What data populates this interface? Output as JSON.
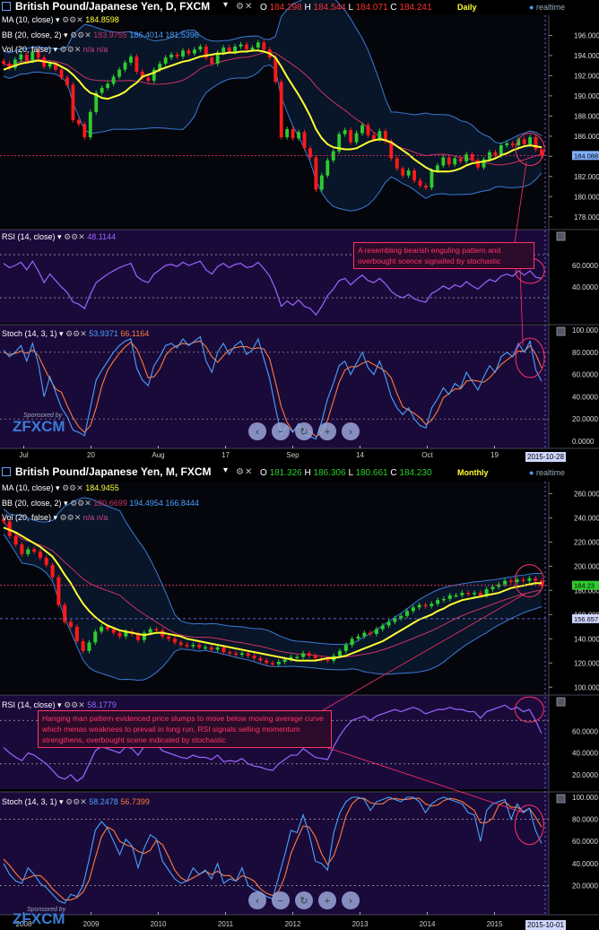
{
  "colors": {
    "bg": "#000000",
    "panel_price": "#04060c",
    "panel_ind": "#1a0a3a",
    "bull": "#2ecc2e",
    "bear": "#ff1a1a",
    "ma": "#ffff33",
    "bb": "#3a7bd5",
    "bb_mid": "#cc3366",
    "rsi": "#9966ff",
    "stoch_k": "#4aa3ff",
    "stoch_d": "#ff7a3a",
    "annotation": "#ff3366",
    "axis_text": "#ffffff"
  },
  "daily": {
    "title": "British Pound/Japanese Yen, D, FXCM",
    "ohlc": {
      "o_label": "O",
      "o": "184.298",
      "h_label": "H",
      "h": "184.544",
      "l_label": "L",
      "l": "184.071",
      "c_label": "C",
      "c": "184.241"
    },
    "period_label": "Daily",
    "realtime": "realtime",
    "ma": {
      "label": "MA (10, close)",
      "value": "184.8598"
    },
    "bb": {
      "label": "BB (20, close, 2)",
      "mid": "183.9755",
      "upper": "186.4014",
      "lower": "181.5396"
    },
    "vol": {
      "label": "Vol (20, false)",
      "value": "n/a n/a"
    },
    "price_ticks": [
      "196.000",
      "194.000",
      "192.000",
      "190.000",
      "188.000",
      "186.000",
      "184.000",
      "182.000",
      "180.000",
      "178.000"
    ],
    "last_price": "184.088",
    "rsi": {
      "label": "RSI (14, close)",
      "value": "48.1144",
      "ticks": [
        "60.0000",
        "40.0000"
      ]
    },
    "stoch": {
      "label": "Stoch (14, 3, 1)",
      "k": "53.9371",
      "d": "66.1164",
      "ticks": [
        "100.000",
        "80.0000",
        "60.0000",
        "40.0000",
        "20.0000",
        "0.0000"
      ]
    },
    "x_labels": [
      "Jul",
      "20",
      "Aug",
      "17",
      "Sep",
      "14",
      "Oct",
      "19"
    ],
    "date_badge": "2015-10-28",
    "annotation": "A resembling bearish enguling pattern and overbought scence signalled by stochastic",
    "sponsored": "Sponsored by",
    "brand": "FXCM"
  },
  "monthly": {
    "title": "British Pound/Japanese Yen, M, FXCM",
    "ohlc": {
      "o_label": "O",
      "o": "181.326",
      "h_label": "H",
      "h": "186.306",
      "l_label": "L",
      "l": "180.661",
      "c_label": "C",
      "c": "184.230"
    },
    "period_label": "Monthly",
    "realtime": "realtime",
    "ma": {
      "label": "MA (10, close)",
      "value": "184.9455"
    },
    "bb": {
      "label": "BB (20, close, 2)",
      "mid": "180.6699",
      "upper": "194.4954",
      "lower": "166.8444"
    },
    "vol": {
      "label": "Vol (20, false)",
      "value": "n/a n/a"
    },
    "price_ticks": [
      "260.000",
      "240.000",
      "220.000",
      "200.000",
      "180.000",
      "160.000",
      "140.000",
      "120.000",
      "100.000"
    ],
    "last_price": "184.23",
    "level_price": "156.657",
    "rsi": {
      "label": "RSI (14, close)",
      "value": "58.1779",
      "ticks": [
        "60.0000",
        "40.0000",
        "20.0000"
      ]
    },
    "stoch": {
      "label": "Stoch (14, 3, 1)",
      "k": "58.2478",
      "d": "56.7399",
      "ticks": [
        "100.000",
        "80.0000",
        "60.0000",
        "40.0000",
        "20.0000"
      ]
    },
    "x_labels": [
      "2008",
      "2009",
      "2010",
      "2011",
      "2012",
      "2013",
      "2014",
      "2015"
    ],
    "date_badge": "2015-10-01",
    "annotation": "Hanging man pattern evidenced price slumps to  move below moving average curve which menas weakness to prevail in long run, RSI signals selling momentum strengthens, overbought scene indicated by stochastic",
    "sponsored": "Sponsored by",
    "brand": "FXCM"
  },
  "chart_data": [
    {
      "type": "candlestick",
      "title": "British Pound/Japanese Yen, D, FXCM",
      "x_ticks": [
        "Jul",
        "20",
        "Aug",
        "17",
        "Sep",
        "14",
        "Oct",
        "19"
      ],
      "ylim": [
        177,
        198
      ],
      "close": [
        193.2,
        192.8,
        193.6,
        194.1,
        193.5,
        194.4,
        193.8,
        192.9,
        193.2,
        192.6,
        191.8,
        191.1,
        187.6,
        187.2,
        185.9,
        188.4,
        190.3,
        190.8,
        191.2,
        191.9,
        192.6,
        193.3,
        193.9,
        192.4,
        191.8,
        191.5,
        192.6,
        193.2,
        193.8,
        194.1,
        193.9,
        194.5,
        194.2,
        194.6,
        194.9,
        193.8,
        193.2,
        194.3,
        194.8,
        194.4,
        194.9,
        195.1,
        194.6,
        194.8,
        195.3,
        194.6,
        193.8,
        191.4,
        185.9,
        186.7,
        185.8,
        186.4,
        184.8,
        183.9,
        180.7,
        182.1,
        183.6,
        184.5,
        186.2,
        186.6,
        185.4,
        186.3,
        187.1,
        186.1,
        185.7,
        186.5,
        185.5,
        183.8,
        182.8,
        182.1,
        182.6,
        181.6,
        181.1,
        180.9,
        182.6,
        183.1,
        183.9,
        183.2,
        183.8,
        183.5,
        184.2,
        183.6,
        182.9,
        183.7,
        184.4,
        184.1,
        185.1,
        185.3,
        185.1,
        185.7,
        185.2,
        185.9,
        184.7,
        184.1
      ],
      "ma10": [
        192.6,
        192.8,
        193.0,
        193.2,
        193.3,
        193.4,
        193.5,
        193.4,
        193.3,
        193.2,
        192.9,
        192.6,
        192.1,
        191.5,
        190.8,
        190.3,
        190.1,
        189.8,
        189.7,
        189.9,
        190.1,
        190.4,
        190.9,
        191.3,
        191.9,
        192.1,
        192.3,
        192.6,
        192.8,
        193.0,
        193.2,
        193.4,
        193.5,
        193.7,
        193.9,
        194.0,
        194.1,
        194.2,
        194.2,
        194.3,
        194.3,
        194.4,
        194.4,
        194.5,
        194.5,
        194.4,
        194.2,
        193.8,
        192.9,
        191.9,
        191.0,
        190.1,
        189.1,
        188.0,
        186.7,
        185.8,
        185.2,
        184.9,
        184.8,
        184.7,
        184.7,
        184.8,
        185.1,
        185.4,
        185.6,
        185.7,
        185.6,
        185.4,
        185.0,
        184.6,
        184.2,
        183.7,
        183.3,
        182.9,
        182.6,
        182.5,
        182.5,
        182.5,
        182.6,
        182.8,
        183.1,
        183.3,
        183.4,
        183.5,
        183.6,
        183.8,
        184.1,
        184.3,
        184.6,
        184.8,
        185.0,
        185.1,
        185.0,
        184.9
      ],
      "rsi": [
        62,
        58,
        60,
        63,
        56,
        64,
        55,
        44,
        52,
        46,
        40,
        35,
        26,
        24,
        20,
        33,
        44,
        48,
        52,
        55,
        58,
        60,
        62,
        50,
        46,
        44,
        52,
        56,
        60,
        61,
        59,
        63,
        60,
        62,
        64,
        56,
        52,
        59,
        62,
        58,
        61,
        62,
        58,
        59,
        63,
        57,
        50,
        38,
        22,
        27,
        23,
        28,
        22,
        20,
        14,
        22,
        32,
        38,
        46,
        48,
        42,
        47,
        51,
        46,
        44,
        48,
        43,
        36,
        32,
        30,
        33,
        29,
        27,
        26,
        34,
        37,
        41,
        38,
        42,
        40,
        45,
        41,
        38,
        43,
        47,
        45,
        50,
        52,
        50,
        55,
        51,
        55,
        49,
        48
      ],
      "stoch_k": [
        82,
        76,
        80,
        86,
        72,
        88,
        70,
        40,
        58,
        44,
        30,
        22,
        10,
        8,
        5,
        30,
        55,
        64,
        72,
        80,
        86,
        90,
        92,
        66,
        55,
        50,
        68,
        76,
        86,
        88,
        84,
        92,
        86,
        90,
        94,
        72,
        62,
        80,
        88,
        78,
        86,
        90,
        78,
        82,
        92,
        74,
        56,
        30,
        6,
        14,
        8,
        16,
        6,
        4,
        2,
        18,
        38,
        52,
        68,
        72,
        60,
        70,
        80,
        66,
        60,
        72,
        58,
        40,
        30,
        24,
        30,
        20,
        14,
        12,
        30,
        38,
        48,
        42,
        52,
        48,
        62,
        54,
        46,
        58,
        68,
        62,
        76,
        80,
        76,
        88,
        80,
        90,
        64,
        54
      ],
      "stoch_d": [
        80,
        78,
        79,
        81,
        79,
        82,
        77,
        66,
        56,
        47,
        44,
        32,
        21,
        13,
        8,
        14,
        30,
        50,
        64,
        72,
        79,
        85,
        89,
        83,
        71,
        57,
        58,
        65,
        77,
        83,
        86,
        88,
        87,
        89,
        90,
        85,
        76,
        71,
        77,
        82,
        84,
        85,
        85,
        83,
        84,
        83,
        74,
        53,
        31,
        17,
        9,
        13,
        10,
        9,
        4,
        8,
        19,
        36,
        53,
        64,
        67,
        67,
        70,
        72,
        69,
        66,
        63,
        57,
        43,
        31,
        28,
        25,
        21,
        15,
        19,
        27,
        39,
        43,
        47,
        47,
        54,
        55,
        54,
        53,
        57,
        63,
        69,
        73,
        77,
        81,
        81,
        86,
        78,
        66
      ]
    },
    {
      "type": "candlestick",
      "title": "British Pound/Japanese Yen, M, FXCM",
      "x_ticks": [
        "2008",
        "2009",
        "2010",
        "2011",
        "2012",
        "2013",
        "2014",
        "2015"
      ],
      "ylim": [
        95,
        270
      ],
      "close": [
        237,
        225,
        218,
        210,
        214,
        212,
        207,
        201,
        191,
        168,
        154,
        150,
        138,
        130,
        137,
        146,
        150,
        148,
        145,
        142,
        146,
        144,
        139,
        145,
        148,
        147,
        142,
        140,
        137,
        135,
        134,
        135,
        133,
        133,
        131,
        133,
        129,
        128,
        127,
        128,
        126,
        124,
        122,
        120,
        119,
        121,
        123,
        125,
        125,
        128,
        126,
        124,
        123,
        122,
        126,
        130,
        135,
        140,
        142,
        145,
        144,
        148,
        151,
        154,
        157,
        159,
        163,
        166,
        168,
        167,
        169,
        172,
        173,
        176,
        176,
        178,
        177,
        178,
        176,
        181,
        183,
        185,
        188,
        187,
        189,
        188,
        190,
        188,
        184
      ],
      "ma10": [
        232,
        230,
        228,
        225,
        222,
        219,
        216,
        212,
        208,
        201,
        193,
        186,
        177,
        169,
        163,
        158,
        154,
        151,
        149,
        147,
        146,
        145,
        144,
        143,
        144,
        145,
        145,
        144,
        143,
        142,
        140,
        139,
        138,
        137,
        136,
        135,
        134,
        133,
        132,
        131,
        130,
        129,
        128,
        127,
        126,
        125,
        124,
        123,
        122,
        122,
        122,
        122,
        123,
        124,
        124,
        125,
        126,
        128,
        130,
        132,
        134,
        136,
        138,
        141,
        144,
        147,
        150,
        153,
        156,
        158,
        160,
        163,
        165,
        168,
        170,
        172,
        173,
        174,
        175,
        176,
        177,
        178,
        180,
        182,
        183,
        184,
        185,
        186,
        186
      ],
      "rsi": [
        45,
        40,
        36,
        33,
        40,
        38,
        34,
        30,
        24,
        18,
        16,
        20,
        14,
        18,
        30,
        42,
        46,
        44,
        42,
        40,
        46,
        44,
        38,
        46,
        50,
        48,
        42,
        40,
        38,
        36,
        35,
        38,
        36,
        36,
        34,
        38,
        32,
        33,
        32,
        35,
        30,
        28,
        27,
        25,
        24,
        30,
        34,
        38,
        38,
        44,
        40,
        36,
        35,
        34,
        46,
        56,
        64,
        70,
        72,
        74,
        70,
        74,
        76,
        78,
        80,
        78,
        80,
        82,
        80,
        76,
        78,
        80,
        80,
        82,
        80,
        80,
        78,
        78,
        72,
        78,
        80,
        82,
        84,
        80,
        82,
        78,
        80,
        70,
        58
      ],
      "stoch_k": [
        40,
        30,
        24,
        22,
        36,
        30,
        22,
        18,
        12,
        6,
        4,
        12,
        10,
        20,
        44,
        70,
        78,
        72,
        60,
        48,
        62,
        56,
        36,
        54,
        66,
        62,
        42,
        34,
        26,
        22,
        24,
        36,
        30,
        34,
        26,
        40,
        22,
        26,
        24,
        36,
        20,
        16,
        14,
        10,
        8,
        28,
        48,
        70,
        68,
        84,
        66,
        42,
        40,
        34,
        68,
        86,
        96,
        100,
        100,
        98,
        88,
        96,
        98,
        100,
        98,
        96,
        100,
        100,
        96,
        86,
        94,
        98,
        100,
        98,
        96,
        94,
        86,
        84,
        60,
        88,
        94,
        96,
        98,
        80,
        94,
        86,
        90,
        70,
        58
      ],
      "stoch_d": [
        44,
        38,
        31,
        25,
        27,
        29,
        29,
        24,
        17,
        12,
        7,
        7,
        9,
        14,
        25,
        45,
        64,
        73,
        70,
        60,
        57,
        55,
        51,
        49,
        52,
        61,
        57,
        46,
        34,
        27,
        24,
        27,
        30,
        33,
        30,
        33,
        29,
        29,
        24,
        29,
        27,
        24,
        17,
        13,
        11,
        15,
        28,
        49,
        62,
        74,
        73,
        64,
        49,
        39,
        47,
        63,
        83,
        94,
        99,
        99,
        95,
        94,
        94,
        98,
        99,
        98,
        98,
        99,
        99,
        94,
        92,
        93,
        97,
        99,
        98,
        96,
        92,
        88,
        77,
        77,
        81,
        93,
        96,
        91,
        91,
        87,
        90,
        82,
        73
      ]
    }
  ]
}
